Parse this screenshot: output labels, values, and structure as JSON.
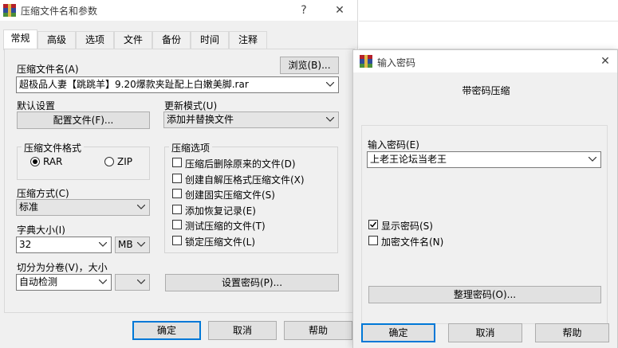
{
  "main_dialog": {
    "title": "压缩文件名和参数",
    "help_icon": "?",
    "close_icon": "✕",
    "tabs": [
      {
        "label": "常规",
        "active": true
      },
      {
        "label": "高级"
      },
      {
        "label": "选项"
      },
      {
        "label": "文件"
      },
      {
        "label": "备份"
      },
      {
        "label": "时间"
      },
      {
        "label": "注释"
      }
    ],
    "archive_name_label": "压缩文件名(A)",
    "browse_button": "浏览(B)...",
    "archive_name_value": "超极品人妻【跳跳羊】9.20爆款夹趾配上白嫩美脚.rar",
    "default_settings_label": "默认设置",
    "profiles_button": "配置文件(F)...",
    "update_mode_label": "更新模式(U)",
    "update_mode_value": "添加并替换文件",
    "format_group_title": "压缩文件格式",
    "format_options": [
      {
        "label": "RAR",
        "selected": true
      },
      {
        "label": "ZIP",
        "selected": false
      }
    ],
    "method_label": "压缩方式(C)",
    "method_value": "标准",
    "dict_label": "字典大小(I)",
    "dict_value": "32",
    "dict_unit": "MB",
    "split_label": "切分为分卷(V)，大小",
    "split_value": "自动检测",
    "options_group_title": "压缩选项",
    "options": [
      {
        "label": "压缩后删除原来的文件(D)",
        "checked": false
      },
      {
        "label": "创建自解压格式压缩文件(X)",
        "checked": false
      },
      {
        "label": "创建固实压缩文件(S)",
        "checked": false
      },
      {
        "label": "添加恢复记录(E)",
        "checked": false
      },
      {
        "label": "测试压缩的文件(T)",
        "checked": false
      },
      {
        "label": "锁定压缩文件(L)",
        "checked": false
      }
    ],
    "set_password_button": "设置密码(P)...",
    "ok_button": "确定",
    "cancel_button": "取消",
    "help_button": "帮助"
  },
  "password_dialog": {
    "title": "输入密码",
    "close_icon": "✕",
    "heading": "带密码压缩",
    "password_label": "输入密码(E)",
    "password_value": "上老王论坛当老王",
    "show_password_label": "显示密码(S)",
    "show_password_checked": true,
    "encrypt_names_label": "加密文件名(N)",
    "encrypt_names_checked": false,
    "organize_button": "整理密码(O)...",
    "ok_button": "确定",
    "cancel_button": "取消",
    "help_button": "帮助"
  },
  "colors": {
    "dialog_bg": "#f0f0f0",
    "titlebar_bg": "#ffffff",
    "button_bg": "#e1e1e1",
    "focus_border": "#0078d7"
  }
}
